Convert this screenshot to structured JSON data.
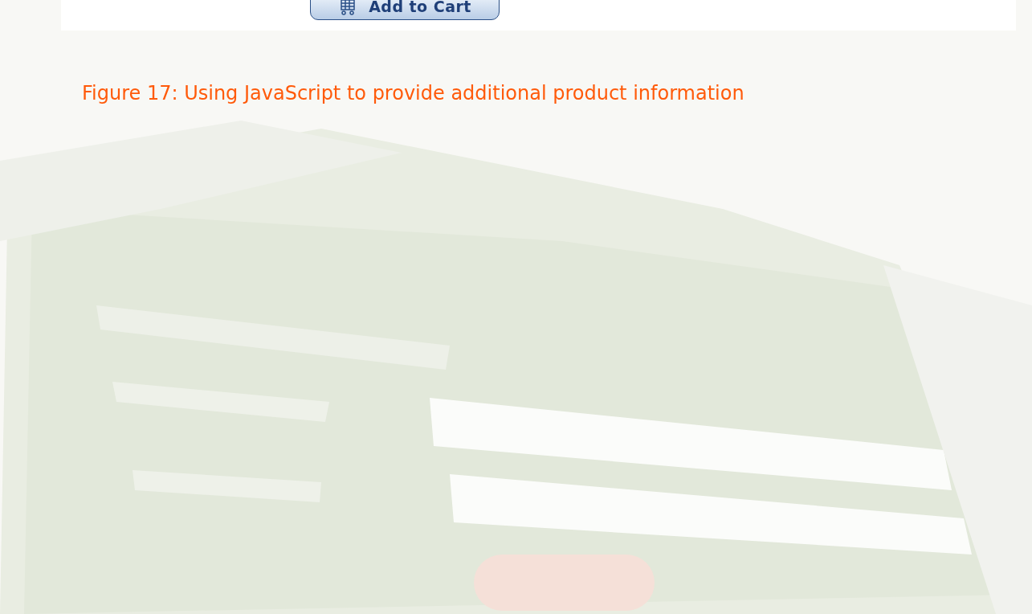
{
  "figure": {
    "button": "Add to Cart"
  },
  "caption": "Figure 17: Using JavaScript to provide additional product information"
}
